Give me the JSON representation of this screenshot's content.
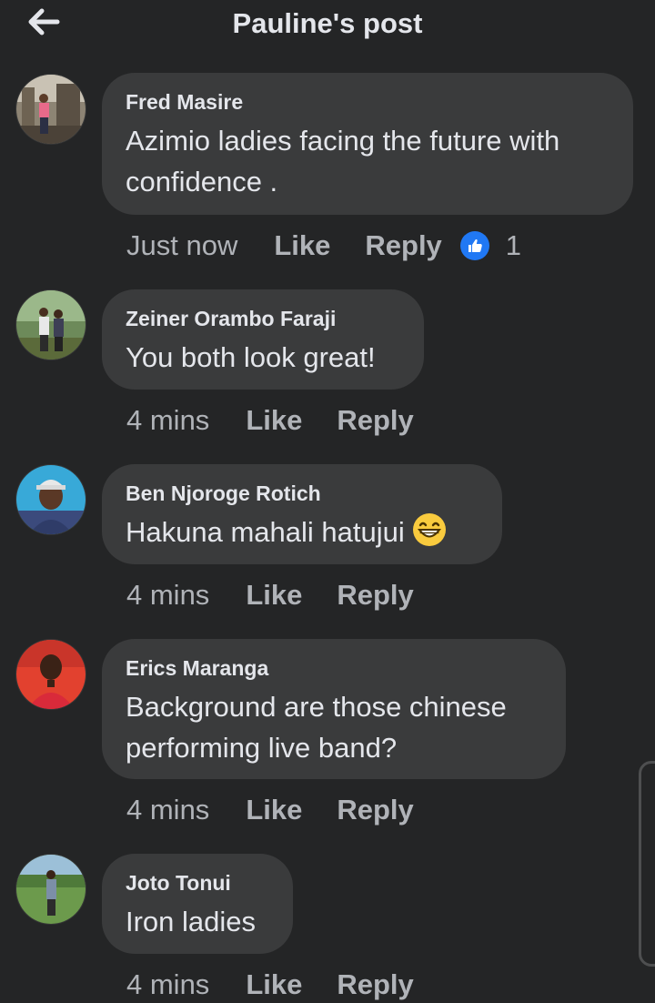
{
  "header": {
    "title": "Pauline's post",
    "back_icon": "arrow-left-icon"
  },
  "comments": [
    {
      "author": "Fred Masire",
      "lines": [
        "Azimio ladies facing the future with",
        "confidence ."
      ],
      "time": "Just now",
      "like_label": "Like",
      "reply_label": "Reply",
      "reaction_count": "1",
      "reaction_icon": "thumbs-up-icon"
    },
    {
      "author": "Zeiner Orambo Faraji",
      "lines": [
        "You both look great!"
      ],
      "time": "4 mins",
      "like_label": "Like",
      "reply_label": "Reply"
    },
    {
      "author": "Ben Njoroge Rotich",
      "lines": [
        "Hakuna mahali hatujui"
      ],
      "emoji": "grinning-face-icon",
      "time": "4 mins",
      "like_label": "Like",
      "reply_label": "Reply"
    },
    {
      "author": "Erics Maranga",
      "lines": [
        "Background are those chinese",
        "performing live band?"
      ],
      "time": "4 mins",
      "like_label": "Like",
      "reply_label": "Reply"
    },
    {
      "author": "Joto Tonui",
      "lines": [
        "Iron ladies"
      ],
      "time": "4 mins",
      "like_label": "Like",
      "reply_label": "Reply"
    }
  ],
  "colors": {
    "background": "#242526",
    "bubble": "#3a3b3c",
    "primary_text": "#e4e6eb",
    "secondary_text": "#b0b3b8",
    "like_blue": "#2078f4"
  }
}
